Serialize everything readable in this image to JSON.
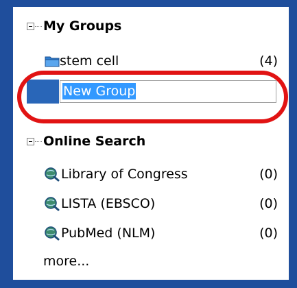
{
  "groups": {
    "header": "My Groups",
    "items": [
      {
        "label": "stem cell",
        "count": "(4)"
      }
    ],
    "rename": {
      "value": "New Group"
    }
  },
  "online_search": {
    "header": "Online Search",
    "items": [
      {
        "label": "Library of Congress",
        "count": "(0)"
      },
      {
        "label": "LISTA (EBSCO)",
        "count": "(0)"
      },
      {
        "label": "PubMed (NLM)",
        "count": "(0)"
      }
    ],
    "more_label": "more..."
  },
  "colors": {
    "frame": "#1f4e9c",
    "selection": "#2966b8",
    "text_highlight": "#3399ff",
    "annotation": "#e11313"
  },
  "icons": {
    "folder": "folder-icon",
    "online_db": "globe-search-icon",
    "collapse": "collapse-minus-icon"
  }
}
